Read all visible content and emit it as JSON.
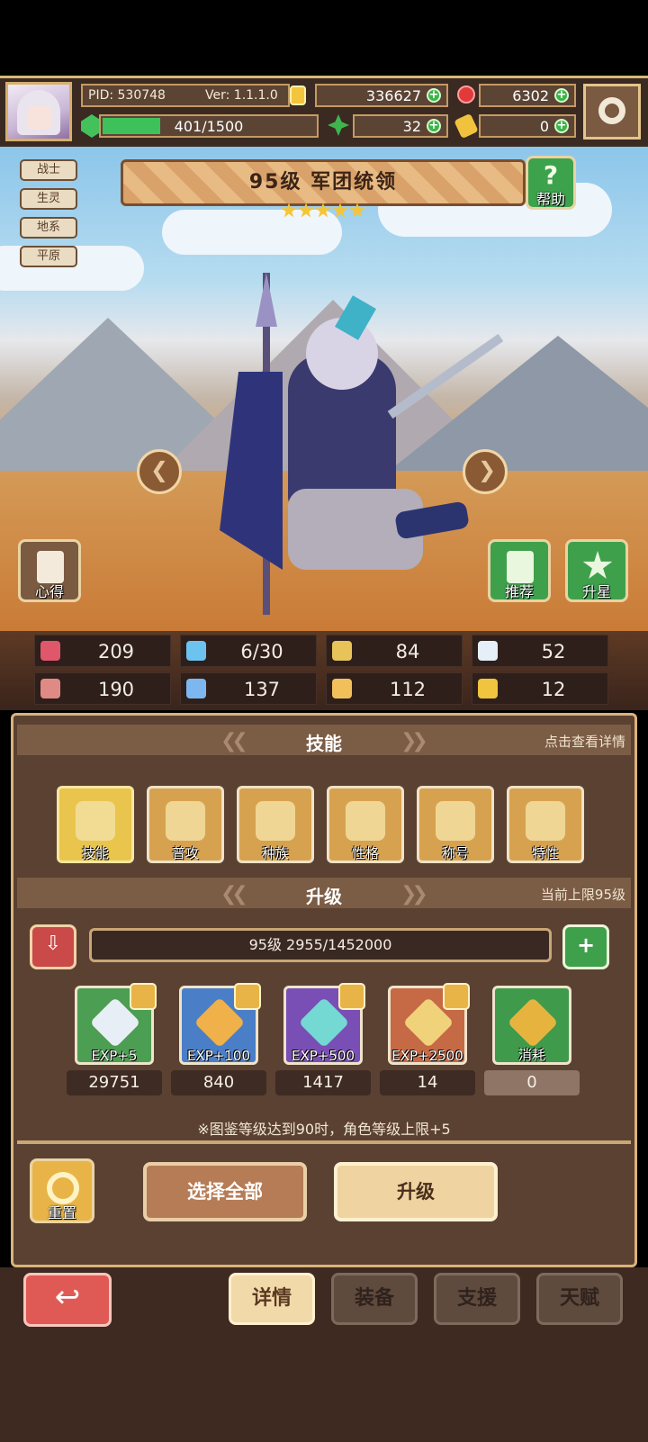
{
  "header": {
    "pid": "PID: 530748",
    "version": "Ver: 1.1.1.0",
    "gold": "336627",
    "gems": "6302",
    "energy": "401/1500",
    "clover": "32",
    "key": "0",
    "energy_fraction": 0.27
  },
  "hero": {
    "tags": [
      "战士",
      "生灵",
      "地系",
      "平原"
    ],
    "title": "95级  军团统领",
    "stars": 5,
    "help_label": "帮助",
    "insight_label": "心得",
    "recommend_label": "推荐",
    "star_up_label": "升星"
  },
  "stats": [
    {
      "icon": "heart-icon",
      "value": "209",
      "color": "#e0566b"
    },
    {
      "icon": "water-drop-icon",
      "value": "6/30",
      "color": "#6cc3f0"
    },
    {
      "icon": "shield-icon",
      "value": "84",
      "color": "#e7c35a"
    },
    {
      "icon": "wing-icon",
      "value": "52",
      "color": "#e6eef7"
    },
    {
      "icon": "fist-icon",
      "value": "190",
      "color": "#e08a86"
    },
    {
      "icon": "book-icon",
      "value": "137",
      "color": "#7cb8ef"
    },
    {
      "icon": "boot-icon",
      "value": "112",
      "color": "#f1c05a"
    },
    {
      "icon": "horseshoe-icon",
      "value": "12",
      "color": "#f0c43e"
    }
  ],
  "skills_section": {
    "title": "技能",
    "hint": "点击查看详情",
    "items": [
      "技能",
      "普攻",
      "种族",
      "性格",
      "称号",
      "特性"
    ]
  },
  "upgrade_section": {
    "title": "升级",
    "hint": "当前上限95级",
    "level_text": "95级  2955/1452000",
    "items": [
      {
        "label": "EXP+5",
        "count": "29751",
        "color": "#4c9e52",
        "gem": "#e8eef6"
      },
      {
        "label": "EXP+100",
        "count": "840",
        "color": "#4a7fc8",
        "gem": "#f0b04a"
      },
      {
        "label": "EXP+500",
        "count": "1417",
        "color": "#7a4fb5",
        "gem": "#73d9d2"
      },
      {
        "label": "EXP+2500",
        "count": "14",
        "color": "#c66a45",
        "gem": "#f0d27a"
      },
      {
        "label": "消耗",
        "count": "0",
        "color": "#3f9a4c",
        "gem": "#e6b43e"
      }
    ],
    "note": "※图鉴等级达到90时，角色等级上限+5"
  },
  "actions": {
    "reset": "重置",
    "select_all": "选择全部",
    "upgrade": "升级"
  },
  "tabs": {
    "details": "详情",
    "equipment": "装备",
    "support": "支援",
    "talent": "天赋"
  }
}
